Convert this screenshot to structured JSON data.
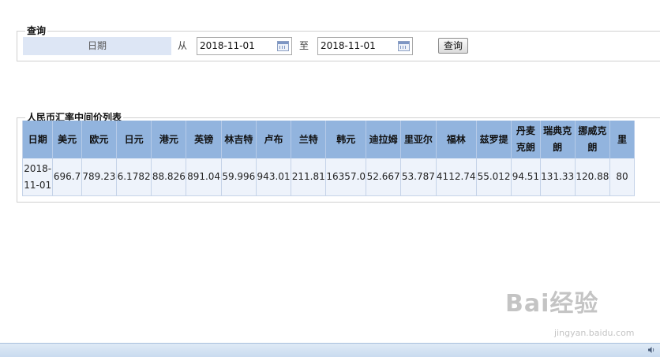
{
  "query": {
    "legend": "查询",
    "date_label": "日期",
    "from_label": "从",
    "from_value": "2018-11-01",
    "to_label": "至",
    "to_value": "2018-11-01",
    "button_label": "查询"
  },
  "rates": {
    "legend": "人民币汇率中间价列表",
    "headers": [
      "日期",
      "美元",
      "欧元",
      "日元",
      "港元",
      "英镑",
      "林吉特",
      "卢布",
      "兰特",
      "韩元",
      "迪拉姆",
      "里亚尔",
      "福林",
      "兹罗提",
      "丹麦克朗",
      "瑞典克朗",
      "挪威克朗",
      "里"
    ],
    "row": [
      "2018-11-01",
      "696.7",
      "789.23",
      "6.1782",
      "88.826",
      "891.04",
      "59.996",
      "943.01",
      "211.81",
      "16357.0",
      "52.667",
      "53.787",
      "4112.74",
      "55.012",
      "94.51",
      "131.33",
      "120.88",
      "80"
    ]
  },
  "watermark": {
    "main": "Bai经验",
    "sub": "jingyan.baidu.com"
  },
  "colors": {
    "header_bg": "#92b4de",
    "cell_bg": "#eef3fb",
    "date_label_bg": "#dde6f5",
    "taskbar": "#c9dbef"
  }
}
